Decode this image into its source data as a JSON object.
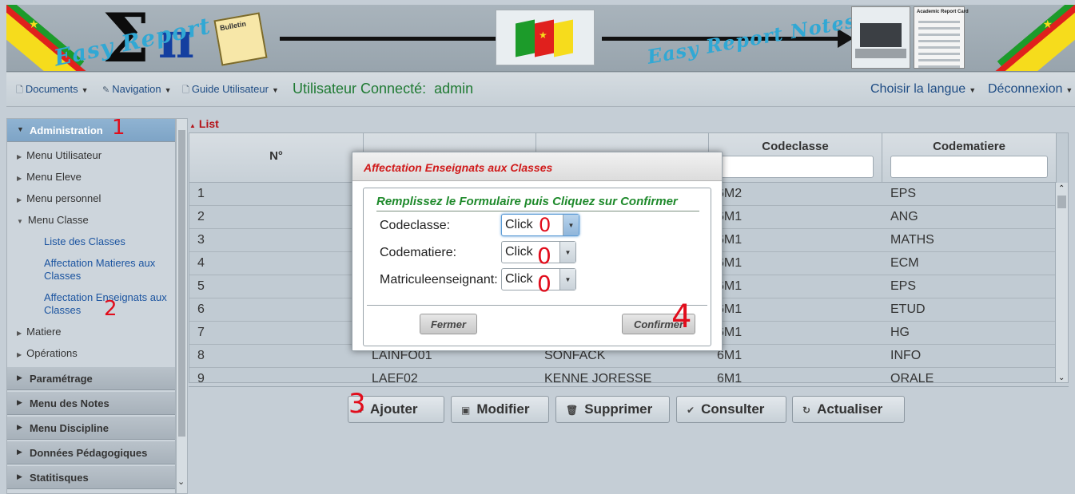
{
  "banner": {
    "logo_text_left": "Easy Report",
    "logo_text_right": "Easy Report Notes",
    "bulletin_label": "Bulletin",
    "card_title": "Academic Report Card"
  },
  "menubar": {
    "documents": "Documents",
    "navigation": "Navigation",
    "guide": "Guide Utilisateur",
    "user_label": "Utilisateur Connecté:",
    "user_name": "admin",
    "language": "Choisir la langue",
    "logout": "Déconnexion"
  },
  "sidebar": {
    "administration": "Administration",
    "menu_utilisateur": "Menu Utilisateur",
    "menu_eleve": "Menu Eleve",
    "menu_personnel": "Menu personnel",
    "menu_classe": "Menu Classe",
    "liste_classes": "Liste des Classes",
    "affectation_matieres": "Affectation Matieres aux Classes",
    "affectation_enseignants": "Affectation Enseignats aux Classes",
    "matiere": "Matiere",
    "operations": "Opérations",
    "parametrage": "Paramétrage",
    "menu_notes": "Menu des Notes",
    "menu_discipline": "Menu Discipline",
    "donnees_pedagogiques": "Données Pédagogiques",
    "statistiques": "Statitisques"
  },
  "list": {
    "title": "List",
    "columns": [
      "N°",
      "",
      "",
      "Codeclasse",
      "Codematiere"
    ],
    "rows": [
      {
        "n": "1",
        "c2": "",
        "c3": "",
        "classe": "6M2",
        "matiere": "EPS"
      },
      {
        "n": "2",
        "c2": "",
        "c3": "",
        "classe": "6M1",
        "matiere": "ANG"
      },
      {
        "n": "3",
        "c2": "",
        "c3": "",
        "classe": "6M1",
        "matiere": "MATHS"
      },
      {
        "n": "4",
        "c2": "",
        "c3": "",
        "classe": "6M1",
        "matiere": "ECM"
      },
      {
        "n": "5",
        "c2": "",
        "c3": "",
        "classe": "6M1",
        "matiere": "EPS"
      },
      {
        "n": "6",
        "c2": "",
        "c3": "",
        "classe": "6M1",
        "matiere": "ETUD"
      },
      {
        "n": "7",
        "c2": "",
        "c3": "",
        "classe": "6M1",
        "matiere": "HG"
      },
      {
        "n": "8",
        "c2": "LAINFO01",
        "c3": "SONFACK",
        "classe": "6M1",
        "matiere": "INFO"
      },
      {
        "n": "9",
        "c2": "LAEF02",
        "c3": "KENNE JORESSE",
        "classe": "6M1",
        "matiere": "ORALE"
      }
    ]
  },
  "toolbar": {
    "ajouter": "Ajouter",
    "modifier": "Modifier",
    "supprimer": "Supprimer",
    "consulter": "Consulter",
    "actualiser": "Actualiser"
  },
  "modal": {
    "title": "Affectation Enseignats aux Classes",
    "form_title": "Remplissez le Formulaire puis Cliquez sur Confirmer",
    "label_codeclasse": "Codeclasse:",
    "label_codematiere": "Codematiere:",
    "label_matricule": "Matriculeenseignant:",
    "value_codeclasse": "Click",
    "value_codematiere": "Click",
    "value_matricule": "Click",
    "fermer": "Fermer",
    "confirmer": "Confirmer"
  },
  "annotations": {
    "step1": "1",
    "step2": "2",
    "step3": "3",
    "step4": "4",
    "zero_a": "0",
    "zero_b": "0",
    "zero_c": "0"
  },
  "colors": {
    "accent_blue": "#1b54a0",
    "modal_title_red": "#d01a1a",
    "form_title_green": "#1f8a2c",
    "annotation_red": "#e10d1c",
    "user_green": "#1f7a33"
  }
}
